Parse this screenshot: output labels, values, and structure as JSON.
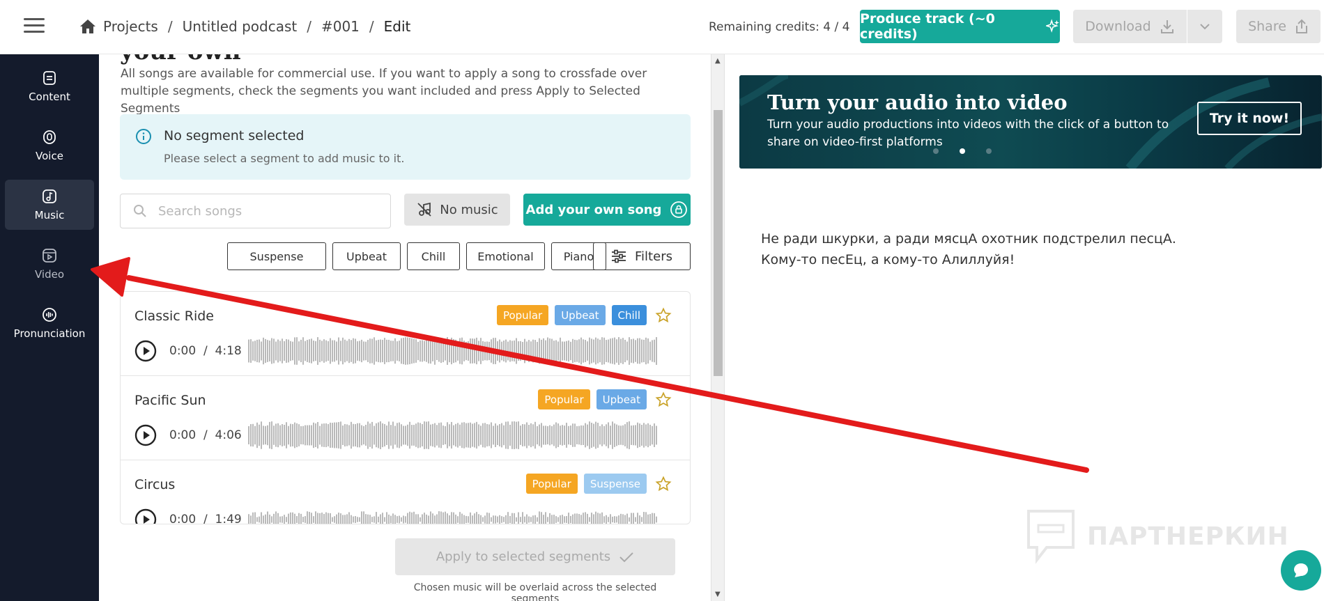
{
  "breadcrumb": {
    "items": [
      "Projects",
      "Untitled podcast",
      "#001",
      "Edit"
    ],
    "separator": "/"
  },
  "header": {
    "credits": "Remaining credits: 4 / 4",
    "produce_label": "Produce track (~0 credits)",
    "download_label": "Download",
    "share_label": "Share"
  },
  "sidebar": {
    "items": [
      {
        "label": "Content",
        "icon": "document-icon"
      },
      {
        "label": "Voice",
        "icon": "microphone-icon"
      },
      {
        "label": "Music",
        "icon": "music-note-icon",
        "active": true
      },
      {
        "label": "Video",
        "icon": "video-icon"
      },
      {
        "label": "Pronunciation",
        "icon": "waveform-icon"
      }
    ]
  },
  "music": {
    "heading_partial": "your own",
    "description": "All songs are available for commercial use. If you want to apply a song to crossfade over multiple segments, check the segments you want included and press Apply to Selected Segments",
    "info_title": "No segment selected",
    "info_subtitle": "Please select a segment to add music to it.",
    "search_placeholder": "Search songs",
    "no_music_label": "No music",
    "add_song_label": "Add your own song",
    "chips": [
      "Suspense",
      "Upbeat",
      "Chill",
      "Emotional",
      "Piano"
    ],
    "filters_label": "Filters",
    "songs": [
      {
        "title": "Classic Ride",
        "current": "0:00",
        "duration": "4:18",
        "badges": [
          "Popular",
          "Upbeat",
          "Chill"
        ]
      },
      {
        "title": "Pacific Sun",
        "current": "0:00",
        "duration": "4:06",
        "badges": [
          "Popular",
          "Upbeat"
        ]
      },
      {
        "title": "Circus",
        "current": "0:00",
        "duration": "1:49",
        "badges": [
          "Popular",
          "Suspense"
        ]
      }
    ],
    "apply_label": "Apply to selected segments",
    "apply_note": "Chosen music will be overlaid across the selected segments"
  },
  "banner": {
    "title": "Turn your audio into video",
    "subtitle": "Turn your audio productions into videos with the click of a button to share on video-first platforms",
    "cta": "Try it now!",
    "slides": 3,
    "active_slide": 2
  },
  "script": {
    "line1": "Не ради шкурки, а ради мясцА охотник подстрелил песцА.",
    "line2": "Кому-то песЕц, а кому-то Алиллуйя!"
  },
  "watermark": "ПАРТНЕРКИН",
  "colors": {
    "accent": "#16a99a",
    "sidebar": "#141b2c",
    "badge_popular": "#f5a623",
    "badge_upbeat": "#6aa9e6",
    "badge_chill": "#3b8fdc",
    "badge_suspense": "#9ccaf0",
    "annotation_arrow": "#e31b1b"
  }
}
